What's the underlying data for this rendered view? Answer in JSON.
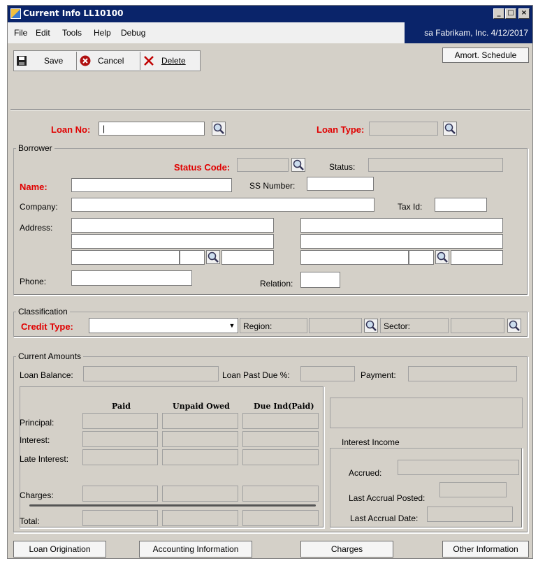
{
  "window": {
    "title": "Current Info LL10100"
  },
  "menu": {
    "items": [
      "File",
      "Edit",
      "Tools",
      "Help",
      "Debug"
    ],
    "user_info": "sa  Fabrikam, Inc.  4/12/2017"
  },
  "toolbar": {
    "save": "Save",
    "cancel": "Cancel",
    "delete": "Delete",
    "amort": "Amort. Schedule"
  },
  "loan": {
    "no_label": "Loan No:",
    "no_value": "",
    "type_label": "Loan Type:",
    "type_value": ""
  },
  "borrower": {
    "group": "Borrower",
    "status_code_label": "Status Code:",
    "status_label": "Status:",
    "name_label": "Name:",
    "ss_label": "SS Number:",
    "company_label": "Company:",
    "taxid_label": "Tax Id:",
    "address_label": "Address:",
    "phone_label": "Phone:",
    "relation_label": "Relation:"
  },
  "classification": {
    "group": "Classification",
    "credit_type_label": "Credit Type:",
    "region_label": "Region:",
    "sector_label": "Sector:"
  },
  "amounts": {
    "group": "Current Amounts",
    "loan_balance_label": "Loan Balance:",
    "past_due_label": "Loan Past Due %:",
    "payment_label": "Payment:",
    "col_paid": "Paid",
    "col_unpaid": "Unpaid Owed",
    "col_due": "Due Ind(Paid)",
    "rows": [
      "Principal:",
      "Interest:",
      "Late Interest:",
      "Charges:",
      "Total:"
    ]
  },
  "interest": {
    "group": "Interest Income",
    "accrued_label": "Accrued:",
    "last_posted_label": "Last Accrual Posted:",
    "last_date_label": "Last Accrual Date:"
  },
  "bottom": {
    "origination": "Loan Origination",
    "accounting": "Accounting Information",
    "charges": "Charges",
    "other": "Other Information"
  }
}
